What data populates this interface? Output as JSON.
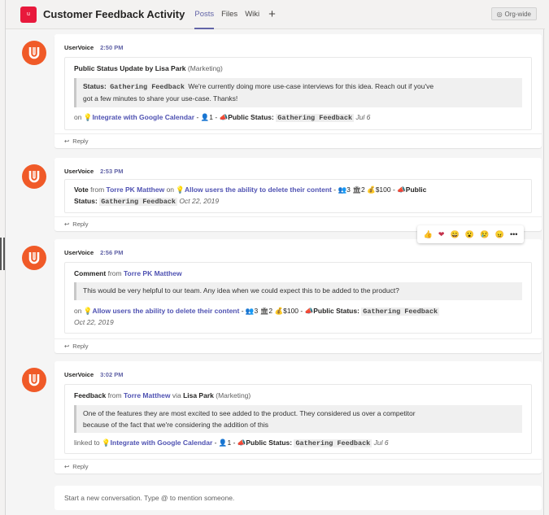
{
  "header": {
    "team_initial": "u",
    "channel_title": "Customer Feedback Activity",
    "tabs": [
      {
        "label": "Posts"
      },
      {
        "label": "Files"
      },
      {
        "label": "Wiki"
      }
    ],
    "add_tab": "+",
    "org_wide": "Org-wide"
  },
  "posts": [
    {
      "author": "UserVoice",
      "time": "2:50 PM",
      "heading": {
        "type": "Public Status Update",
        "by": "by",
        "person": "Lisa Park",
        "dept": "(Marketing)"
      },
      "status_label": "Status:",
      "status_value": "Gathering Feedback",
      "quote_1": "We're currently doing more use-case interviews for this idea. Reach out if you've",
      "quote_2": "got a few minutes to share your use-case. Thanks!",
      "footer": {
        "prefix": "on",
        "idea": "Integrate with Google Calendar",
        "sep": "-",
        "votes": "1",
        "sep2": "-",
        "public_status": "Public Status:",
        "status": "Gathering Feedback",
        "date": "Jul 6"
      },
      "reply": "Reply"
    },
    {
      "author": "UserVoice",
      "time": "2:53 PM",
      "line_1": {
        "type": "Vote",
        "from": "from",
        "person": "Torre PK Matthew",
        "on": "on",
        "idea": "Allow users the ability to delete their content",
        "sep": "-",
        "votes": "3",
        "count2": "2",
        "money": "$100",
        "sep2": "-",
        "public_status": "Public"
      },
      "line_2": {
        "status_word": "Status:",
        "status": "Gathering Feedback",
        "date": "Oct 22, 2019"
      },
      "reply": "Reply"
    },
    {
      "author": "UserVoice",
      "time": "2:56 PM",
      "heading": {
        "type": "Comment",
        "from": "from",
        "person": "Torre PK Matthew"
      },
      "quote": "This would be very helpful to our team. Any idea when we could expect this to be added to the product?",
      "footer": {
        "prefix": "on",
        "idea": "Allow users the ability to delete their content",
        "sep": "-",
        "votes": "3",
        "count2": "2",
        "money": "$100",
        "sep2": "-",
        "public_status": "Public Status:",
        "status": "Gathering Feedback",
        "date": "Oct 22, 2019"
      },
      "reply": "Reply"
    },
    {
      "author": "UserVoice",
      "time": "3:02 PM",
      "heading": {
        "type": "Feedback",
        "from": "from",
        "person": "Torre Matthew",
        "via": "via",
        "via_person": "Lisa Park",
        "dept": "(Marketing)"
      },
      "quote_1": "One of the features they are most excited to see added to the product. They considered us over a competitor",
      "quote_2": "because of the fact that we're considering the addition of this",
      "footer": {
        "prefix": "linked to",
        "idea": "Integrate with Google Calendar",
        "sep": "-",
        "votes": "1",
        "sep2": "-",
        "public_status": "Public Status:",
        "status": "Gathering Feedback",
        "date": "Jul 6"
      },
      "reply": "Reply"
    }
  ],
  "reactions": [
    "👍",
    "❤",
    "😄",
    "😮",
    "😢",
    "😠",
    "•••"
  ],
  "composer": {
    "placeholder": "Start a new conversation. Type @ to mention someone."
  },
  "icons": {
    "avatar": "uservoice-logo-icon",
    "idea": "lightbulb-icon",
    "vote": "person-icon",
    "multi_vote": "people-icon",
    "building": "building-icon",
    "money": "money-bag-icon",
    "status": "megaphone-icon",
    "reply": "reply-arrow-icon",
    "globe": "globe-icon"
  },
  "colors": {
    "accent": "#6264a7",
    "link": "#4f52b2",
    "avatar": "#f05a28",
    "team": "#e8193c"
  }
}
